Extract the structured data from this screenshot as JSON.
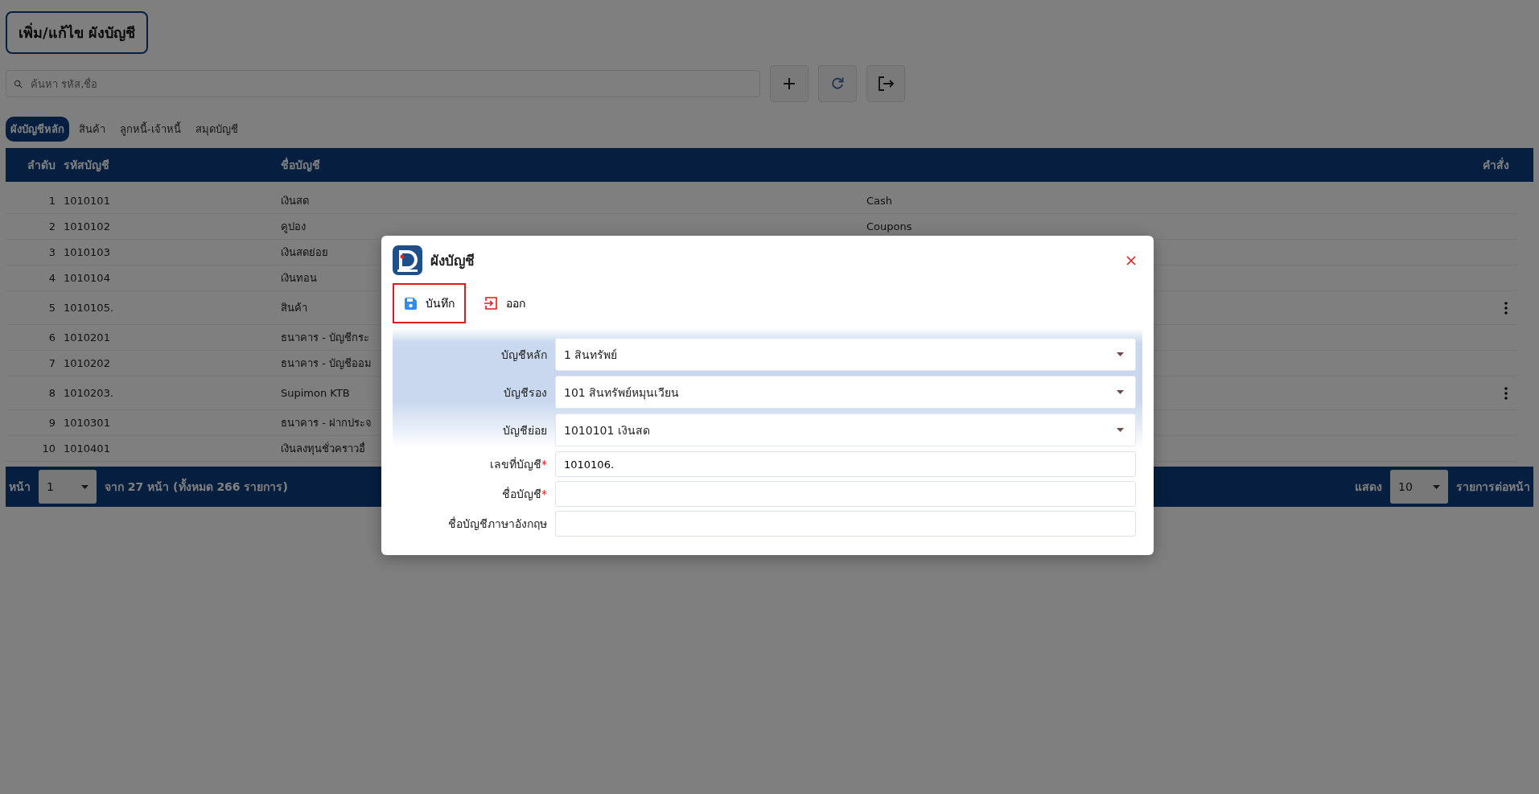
{
  "page": {
    "title": "เพิ่ม/แก้ไข ผังบัญชี"
  },
  "search": {
    "placeholder": "ค้นหา รหัส,ชื่อ"
  },
  "tabs": [
    {
      "label": "ผังบัญชีหลัก",
      "selected": true
    },
    {
      "label": "สินค้า",
      "selected": false
    },
    {
      "label": "ลูกหนี้-เจ้าหนี้",
      "selected": false
    },
    {
      "label": "สมุดบัญชี",
      "selected": false
    }
  ],
  "table": {
    "columns": [
      "ลำดับ",
      "รหัสบัญชี",
      "ชื่อบัญชี",
      "คำสั่ง"
    ],
    "rows": [
      {
        "no": "1",
        "code": "1010101",
        "name": "เงินสด",
        "name_en": "Cash",
        "has_menu": false
      },
      {
        "no": "2",
        "code": "1010102",
        "name": "คูปอง",
        "name_en": "Coupons",
        "has_menu": false
      },
      {
        "no": "3",
        "code": "1010103",
        "name": "เงินสดย่อย",
        "has_menu": false
      },
      {
        "no": "4",
        "code": "1010104",
        "name": "เงินทอน",
        "has_menu": false
      },
      {
        "no": "5",
        "code": "1010105.",
        "name": "สินค้า",
        "has_menu": true
      },
      {
        "no": "6",
        "code": "1010201",
        "name": "ธนาคาร - บัญชีกระ",
        "has_menu": false
      },
      {
        "no": "7",
        "code": "1010202",
        "name": "ธนาคาร - บัญชีออม",
        "has_menu": false
      },
      {
        "no": "8",
        "code": "1010203.",
        "name": "Supimon KTB",
        "has_menu": true
      },
      {
        "no": "9",
        "code": "1010301",
        "name": "ธนาคาร - ฝากประจ",
        "has_menu": false
      },
      {
        "no": "10",
        "code": "1010401",
        "name": "เงินลงทุนชั่วคราวอื่",
        "has_menu": false
      }
    ]
  },
  "pager": {
    "page_label": "หน้า",
    "page": "1",
    "summary": "จาก 27 หน้า (ทั้งหมด 266 รายการ)",
    "show_label": "แสดง",
    "page_size": "10",
    "per_page_label": "รายการต่อหน้า"
  },
  "dialog": {
    "title": "ผังบัญชี",
    "required_mark": "*",
    "actions": [
      {
        "kind": "save",
        "label": "บันทึก",
        "highlighted": true
      },
      {
        "kind": "exit",
        "label": "ออก",
        "highlighted": false
      }
    ],
    "fields": [
      {
        "kind": "select",
        "label": "บัญชีหลัก",
        "required": false,
        "value": "1 สินทรัพย์"
      },
      {
        "kind": "select",
        "label": "บัญชีรอง",
        "required": false,
        "value": "101 สินทรัพย์หมุนเวียน"
      },
      {
        "kind": "select",
        "label": "บัญชีย่อย",
        "required": false,
        "value": "1010101 เงินสด"
      },
      {
        "kind": "input",
        "label": "เลขที่บัญชี",
        "required": true,
        "value": "1010106."
      },
      {
        "kind": "input",
        "label": "ชื่อบัญชี",
        "required": true
      },
      {
        "kind": "input",
        "label": "ชื่อบัญชีภาษาอังกฤษ",
        "required": false
      }
    ]
  }
}
